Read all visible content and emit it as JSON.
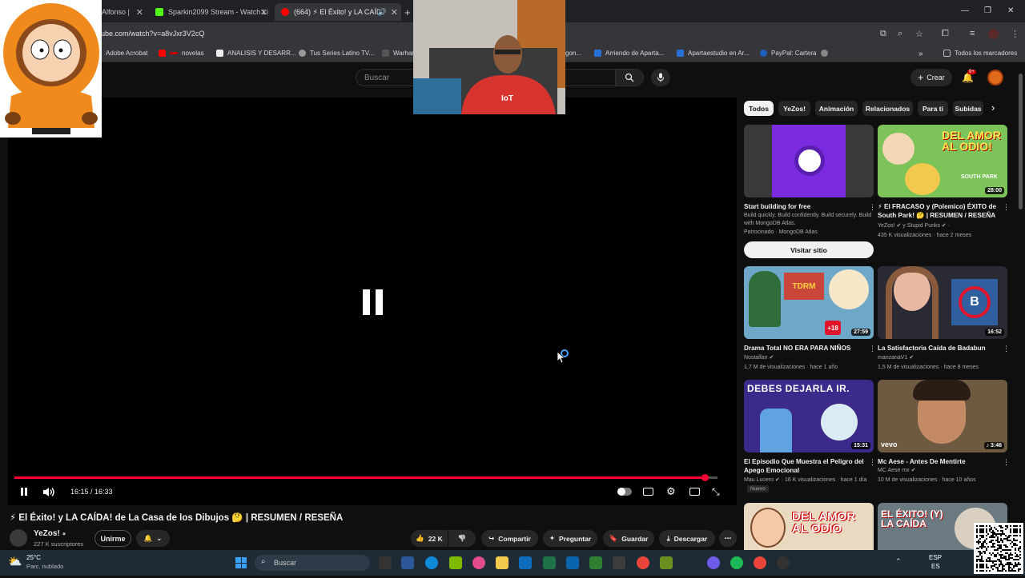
{
  "browser": {
    "tabs": [
      {
        "label": "Alfonso |",
        "active": false
      },
      {
        "label": "Sparkin2099 Stream - Watch Li",
        "active": false
      },
      {
        "label": "(664) ⚡ El Éxito! y LA CAÍDA",
        "active": true
      }
    ],
    "new_tab": "+",
    "url": "ube.com/watch?v=a8vJxr3V2cQ",
    "bookmarks": [
      {
        "label": "Adobe Acrobat",
        "color": "#e13a2c"
      },
      {
        "label": "novelas",
        "color": "#ff0000"
      },
      {
        "label": "ANALISIS Y DESARR...",
        "color": "#444444"
      },
      {
        "label": "Tus Series Latino TV...",
        "color": "#777777"
      },
      {
        "label": "Warhar",
        "color": "#555555"
      },
      {
        "label": "gon...",
        "color": "#2a6fd6"
      },
      {
        "label": "Arriendo de Aparta...",
        "color": "#2a6fd6"
      },
      {
        "label": "Apartaestudio en Ar...",
        "color": "#2a6fd6"
      },
      {
        "label": "PayPal: Cartera",
        "color": "#1f5fbf"
      }
    ],
    "all_bookmarks": "Todos los marcadores"
  },
  "youtube": {
    "search_placeholder": "Buscar",
    "create_label": "Crear",
    "notif_badge": "9+"
  },
  "player": {
    "time": "16:15 / 16:33",
    "progress": 0.982
  },
  "video": {
    "title": "⚡ El Éxito! y LA CAÍDA! de La Casa de los Dibujos 🤔 | RESUMEN / RESEÑA",
    "channel": "YeZos!",
    "subscribers": "227 K suscriptores",
    "join": "Unirme",
    "likes": "22 K",
    "share": "Compartir",
    "ask": "Preguntar",
    "save": "Guardar",
    "download": "Descargar"
  },
  "chips": [
    "Todos",
    "YeZos!",
    "Animación",
    "Relacionados",
    "Para ti",
    "Subidas"
  ],
  "sidebar": {
    "ad": {
      "title": "Start building for free",
      "desc": "Build quickly. Build confidently. Build securely. Build with MongoDB Atlas.",
      "sponsor": "Patrocinado · MongoDB Atlas",
      "cta": "Visitar sitio"
    },
    "videos": [
      {
        "title": "⚡ El FRACASO y (Polemico) ÉXITO de South Park! 🤔 | RESUMEN / RESEÑA",
        "channel": "YeZos! ✔ y Stupid Punks ✔ ·",
        "meta": "435 K visualizaciones · hace 2 meses",
        "duration": "28:00",
        "thumb_text": "DEL AMOR AL ODIO!",
        "thumb_sub": "SOUTH PARK"
      },
      {
        "title": "Drama Total NO ERA PARA NIÑOS",
        "channel": "Nostalfan ✔",
        "meta": "1,7 M de visualizaciones · hace 1 año",
        "duration": "27:59",
        "thumb_text": "TDRM",
        "thumb_sub": "+18"
      },
      {
        "title": "La Satisfactoria Caída de Badabun",
        "channel": "manzanaV1 ✔",
        "meta": "1,5 M de visualizaciones · hace 8 meses",
        "duration": "16:52",
        "thumb_text": "B",
        "thumb_sub": ""
      },
      {
        "title": "El Episodio Que Muestra el Peligro del Apego Emocional",
        "channel": "Mau Lucero ✔ · 16 K visualizaciones · hace 1 día",
        "meta": "Nuevo",
        "duration": "15:31",
        "thumb_text": "DEBES DEJARLA IR.",
        "thumb_sub": ""
      },
      {
        "title": "Mc Aese - Antes De Mentirte",
        "channel": "MC Aese mx ✔",
        "meta": "10 M de visualizaciones · hace 10 años",
        "duration": "♪ 3:46",
        "thumb_text": "vevo",
        "thumb_sub": ""
      },
      {
        "title": "",
        "channel": "",
        "meta": "",
        "duration": "",
        "thumb_text": "DEL AMOR AL ODIO",
        "thumb_sub": ""
      },
      {
        "title": "",
        "channel": "",
        "meta": "",
        "duration": "",
        "thumb_text": "EL ÉXITO! (Y) LA CAÍDA",
        "thumb_sub": ""
      }
    ]
  },
  "taskbar": {
    "temp": "25°C",
    "weather": "Parc. nublado",
    "search": "Buscar",
    "lang1": "ESP",
    "lang2": "ES"
  },
  "webcam": {
    "shirt_text": "IoT"
  }
}
